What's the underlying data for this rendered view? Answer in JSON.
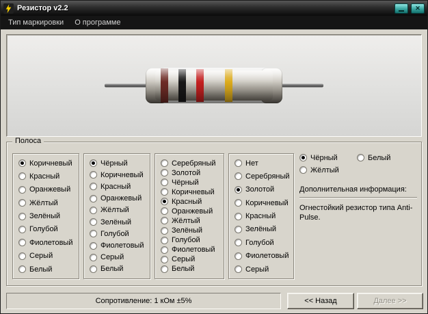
{
  "window": {
    "title": "Резистор v2.2",
    "accent_teal": "#2f9e9a"
  },
  "menu": {
    "items": [
      {
        "label": "Тип маркировки"
      },
      {
        "label": "О программе"
      }
    ]
  },
  "picture": {
    "resistor_bands": [
      {
        "name": "коричневый",
        "color": "#6d2c26"
      },
      {
        "name": "чёрный",
        "color": "#181818"
      },
      {
        "name": "красный",
        "color": "#c32020"
      },
      {
        "name": "золотой",
        "color": "#dcab1d"
      }
    ],
    "body_color": "#cfccc4",
    "lead_color": "#6f6f6f"
  },
  "band_group": {
    "title": "Полоса",
    "band1": {
      "options": [
        {
          "label": "Коричневый",
          "selected": true
        },
        {
          "label": "Красный"
        },
        {
          "label": "Оранжевый"
        },
        {
          "label": "Жёлтый"
        },
        {
          "label": "Зелёный"
        },
        {
          "label": "Голубой"
        },
        {
          "label": "Фиолетовый"
        },
        {
          "label": "Серый"
        },
        {
          "label": "Белый"
        }
      ]
    },
    "band2": {
      "options": [
        {
          "label": "Чёрный",
          "selected": true
        },
        {
          "label": "Коричневый"
        },
        {
          "label": "Красный"
        },
        {
          "label": "Оранжевый"
        },
        {
          "label": "Жёлтый"
        },
        {
          "label": "Зелёный"
        },
        {
          "label": "Голубой"
        },
        {
          "label": "Фиолетовый"
        },
        {
          "label": "Серый"
        },
        {
          "label": "Белый"
        }
      ]
    },
    "band3": {
      "options": [
        {
          "label": "Серебряный"
        },
        {
          "label": "Золотой"
        },
        {
          "label": "Чёрный"
        },
        {
          "label": "Коричневый"
        },
        {
          "label": "Красный",
          "selected": true
        },
        {
          "label": "Оранжевый"
        },
        {
          "label": "Жёлтый"
        },
        {
          "label": "Зелёный"
        },
        {
          "label": "Голубой"
        },
        {
          "label": "Фиолетовый"
        },
        {
          "label": "Серый"
        },
        {
          "label": "Белый"
        }
      ]
    },
    "band4": {
      "options": [
        {
          "label": "Нет"
        },
        {
          "label": "Серебряный"
        },
        {
          "label": "Золотой",
          "selected": true
        },
        {
          "label": "Коричневый"
        },
        {
          "label": "Красный"
        },
        {
          "label": "Зелёный"
        },
        {
          "label": "Голубой"
        },
        {
          "label": "Фиолетовый"
        },
        {
          "label": "Серый"
        }
      ]
    },
    "extra": {
      "options": [
        {
          "label": "Чёрный",
          "selected": true
        },
        {
          "label": "Белый"
        },
        {
          "label": "Жёлтый"
        }
      ]
    }
  },
  "info": {
    "label": "Дополнительная информация:",
    "text": "Огнестойкий резистор типа Anti-Pulse."
  },
  "status": {
    "resistance": "Сопротивление: 1 кОм ±5%"
  },
  "nav": {
    "back": "<< Назад",
    "next": "Далее >>"
  }
}
